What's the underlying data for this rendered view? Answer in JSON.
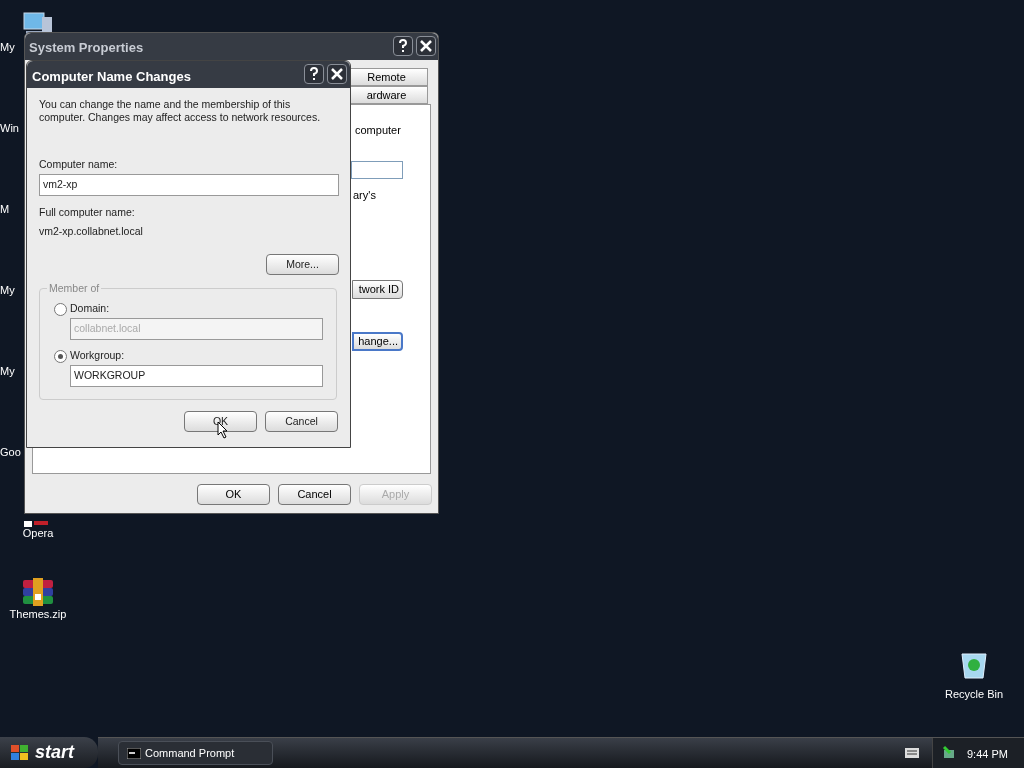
{
  "desktop_icons": [
    {
      "label": "My",
      "kind": "computer"
    },
    {
      "label": "Win",
      "kind": "hidden"
    },
    {
      "label": "M",
      "kind": "hidden"
    },
    {
      "label": "My",
      "kind": "hidden"
    },
    {
      "label": "My",
      "kind": "hidden"
    },
    {
      "label": "Goo",
      "kind": "hidden"
    },
    {
      "label": "Opera",
      "kind": "opera"
    },
    {
      "label": "Themes.zip",
      "kind": "archive"
    }
  ],
  "recycle_bin": {
    "label": "Recycle Bin"
  },
  "system_properties": {
    "title": "System Properties",
    "tabs": [
      {
        "label": "Remote",
        "selected": false
      },
      {
        "label": "ardware",
        "selected": false
      }
    ],
    "text_1": "computer",
    "text_2": "ary's",
    "buttons_panel": [
      {
        "label": "twork ID",
        "focused": false
      },
      {
        "label": "hange...",
        "focused": true
      }
    ],
    "buttons": [
      {
        "label": "OK",
        "disabled": false
      },
      {
        "label": "Cancel",
        "disabled": false
      },
      {
        "label": "Apply",
        "disabled": true
      }
    ]
  },
  "dialog": {
    "title": "Computer Name Changes",
    "description": "You can change the name and the membership of this computer. Changes may affect access to network resources.",
    "computer_name_label": "Computer name:",
    "computer_name": "vm2-xp",
    "full_name_label": "Full computer name:",
    "full_name": "vm2-xp.collabnet.local",
    "more_button": "More...",
    "member_of": "Member of",
    "options": [
      {
        "label": "Domain:",
        "selected": false,
        "value": "collabnet.local"
      },
      {
        "label": "Workgroup:",
        "selected": true,
        "value": "WORKGROUP"
      }
    ],
    "buttons": [
      "OK",
      "Cancel"
    ]
  },
  "taskbar": {
    "start": "start",
    "tasks": [
      {
        "label": "Command Prompt"
      }
    ],
    "clock": "9:44 PM"
  }
}
